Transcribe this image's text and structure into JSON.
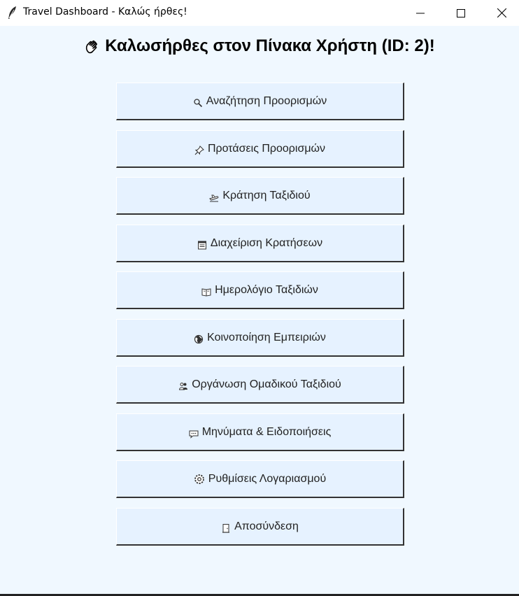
{
  "window": {
    "title": "Travel Dashboard - Καλώς ήρθες!"
  },
  "heading": {
    "text": "Καλωσήρθες στον Πίνακα Χρήστη (ID: 2)!"
  },
  "menu": [
    {
      "label": "Αναζήτηση Προορισμών",
      "icon": "magnifier-icon"
    },
    {
      "label": "Προτάσεις Προορισμών",
      "icon": "pushpin-icon"
    },
    {
      "label": "Κράτηση Ταξιδιού",
      "icon": "airplane-icon"
    },
    {
      "label": "Διαχείριση Κρατήσεων",
      "icon": "notepad-icon"
    },
    {
      "label": "Ημερολόγιο Ταξιδιών",
      "icon": "book-icon"
    },
    {
      "label": "Κοινοποίηση Εμπειριών",
      "icon": "globe-icon"
    },
    {
      "label": "Οργάνωση Ομαδικού Ταξιδιού",
      "icon": "group-icon"
    },
    {
      "label": "Μηνύματα & Ειδοποιήσεις",
      "icon": "speech-bubble-icon"
    },
    {
      "label": "Ρυθμίσεις Λογαριασμού",
      "icon": "gear-icon"
    },
    {
      "label": "Αποσύνδεση",
      "icon": "door-icon"
    }
  ]
}
